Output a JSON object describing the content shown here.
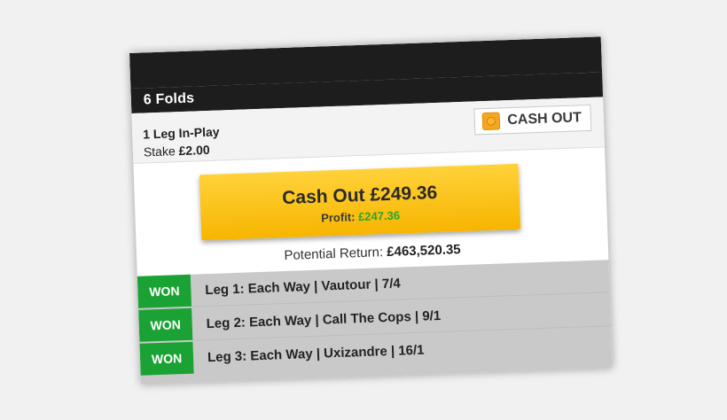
{
  "bet": {
    "title": "6 Folds",
    "legs_inplay": "1 Leg In-Play",
    "stake_label": "Stake",
    "stake_value": "£2.00",
    "cashout_badge": "CASH OUT"
  },
  "cashout": {
    "amount_label": "Cash Out £249.36",
    "profit_label": "Profit:",
    "profit_value": "£247.36"
  },
  "potential": {
    "label": "Potential Return:",
    "value": "£463,520.35"
  },
  "legs": [
    {
      "status": "WON",
      "text": "Leg 1: Each Way | Vautour | 7/4"
    },
    {
      "status": "WON",
      "text": "Leg 2: Each Way | Call The Cops | 9/1"
    },
    {
      "status": "WON",
      "text": "Leg 3: Each Way | Uxizandre | 16/1"
    }
  ],
  "colors": {
    "header_bg": "#1d1d1d",
    "cashout_button": "#f7b500",
    "won_badge": "#1aa334",
    "profit_text": "#2aa52a",
    "legs_bg": "#c9c9c9"
  },
  "icons": {
    "cashout_badge_icon": "cashout-coin-icon"
  }
}
